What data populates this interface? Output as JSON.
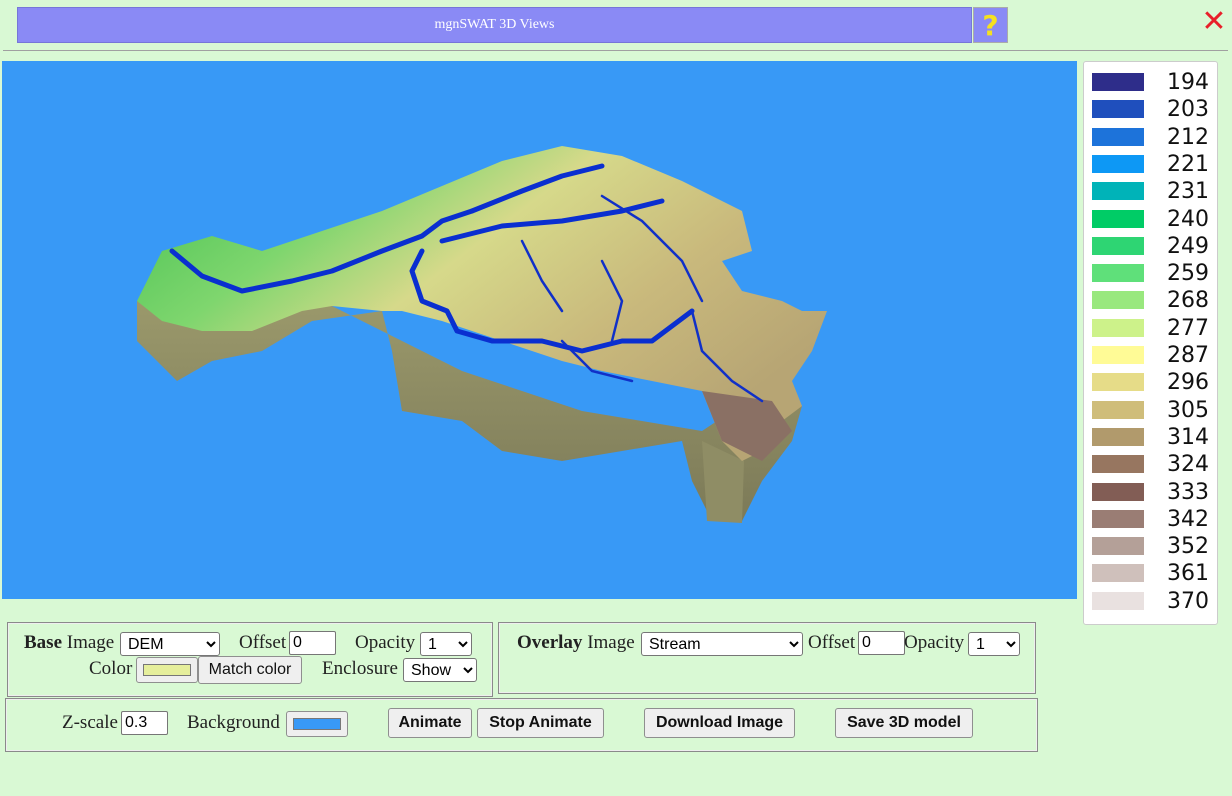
{
  "window": {
    "title": "mgnSWAT 3D Views",
    "help_label": "?",
    "close_label": "✕"
  },
  "legend": {
    "items": [
      {
        "label": "194",
        "color": "#2e2d8a"
      },
      {
        "label": "203",
        "color": "#1f4fbd"
      },
      {
        "label": "212",
        "color": "#1d73da"
      },
      {
        "label": "221",
        "color": "#0d98f5"
      },
      {
        "label": "231",
        "color": "#00b3b8"
      },
      {
        "label": "240",
        "color": "#00cc66"
      },
      {
        "label": "249",
        "color": "#2ed573"
      },
      {
        "label": "259",
        "color": "#5fe07a"
      },
      {
        "label": "268",
        "color": "#99e87e"
      },
      {
        "label": "277",
        "color": "#cdf28a"
      },
      {
        "label": "287",
        "color": "#fffb96"
      },
      {
        "label": "296",
        "color": "#e6dc88"
      },
      {
        "label": "305",
        "color": "#cfbd7a"
      },
      {
        "label": "314",
        "color": "#b19a6c"
      },
      {
        "label": "324",
        "color": "#977660"
      },
      {
        "label": "333",
        "color": "#825d55"
      },
      {
        "label": "342",
        "color": "#9a7d74"
      },
      {
        "label": "352",
        "color": "#b4a098"
      },
      {
        "label": "361",
        "color": "#cfc0bb"
      },
      {
        "label": "370",
        "color": "#e9e1e0"
      }
    ]
  },
  "base": {
    "heading": "Base",
    "image_label": "Image",
    "image_value": "DEM",
    "offset_label": "Offset",
    "offset_value": "0",
    "opacity_label": "Opacity",
    "opacity_value": "1",
    "color_label": "Color",
    "color_value": "#e6ef9c",
    "match_color_label": "Match color",
    "enclosure_label": "Enclosure",
    "enclosure_value": "Show"
  },
  "overlay": {
    "heading": "Overlay",
    "image_label": "Image",
    "image_value": "Stream",
    "offset_label": "Offset",
    "offset_value": "0",
    "opacity_label": "Opacity",
    "opacity_value": "1"
  },
  "controls": {
    "zscale_label": "Z-scale",
    "zscale_value": "0.3",
    "background_label": "Background",
    "background_color": "#3899f6",
    "animate_label": "Animate",
    "stop_animate_label": "Stop Animate",
    "download_label": "Download Image",
    "save_model_label": "Save 3D model"
  }
}
